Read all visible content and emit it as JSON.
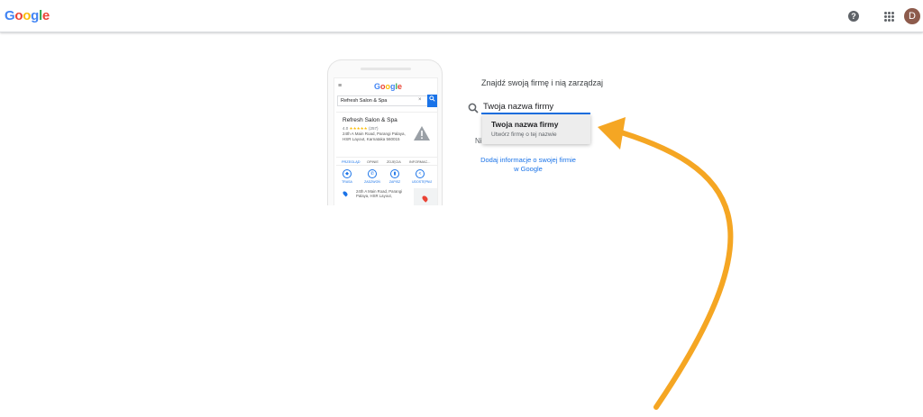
{
  "header": {
    "logo_text": "Google",
    "help_label": "?",
    "avatar_initial": "D"
  },
  "phone": {
    "logo_text": "Google",
    "menu_glyph": "≡",
    "search_value": "Refresh Salon & Spa",
    "clear_glyph": "×",
    "business": {
      "name": "Refresh Salon & Spa",
      "rating": "4.0",
      "stars": "★★★★★",
      "reviews": "(257)",
      "address": "24th A Main Road, Parangi Palaya, HSR Layout, Karnataka 560015"
    },
    "tabs": [
      "PRZEGLĄD",
      "OPINIE",
      "ZDJĘCIA",
      "INFORMAC..."
    ],
    "actions": [
      "TRASA",
      "ZADZWOŃ",
      "ZAPISZ",
      "UDOSTĘPNIJ"
    ],
    "location_text": "24th A Main Road, Parangi Palaya, HSR Layout,"
  },
  "main": {
    "heading": "Znajdź swoją firmę i nią zarządzaj",
    "search_value": "Twoja nazwa firmy",
    "partial_text": "Ni",
    "suggestion": {
      "title": "Twoja nazwa firmy",
      "subtitle": "Utwórz firmę o tej nazwie"
    },
    "add_link": "Dodaj informacje o swojej firmie w Google"
  },
  "colors": {
    "accent": "#1a73e8",
    "arrow": "#f5a623",
    "avatar": "#8d5b4c"
  }
}
